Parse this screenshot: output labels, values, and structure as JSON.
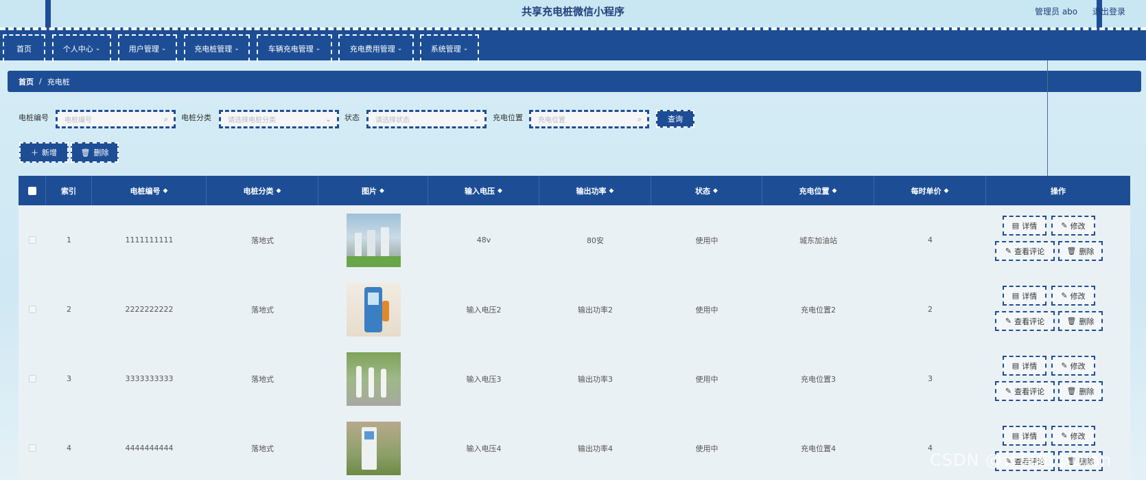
{
  "header": {
    "title": "共享充电桩微信小程序",
    "user": "管理员 abo",
    "logout": "退出登录"
  },
  "nav": [
    {
      "label": "首页",
      "chevron": ""
    },
    {
      "label": "个人中心",
      "chevron": "⌄"
    },
    {
      "label": "用户管理",
      "chevron": "⌄"
    },
    {
      "label": "充电桩管理",
      "chevron": "⌄"
    },
    {
      "label": "车辆充电管理",
      "chevron": "⌄"
    },
    {
      "label": "充电费用管理",
      "chevron": "⌄"
    },
    {
      "label": "系统管理",
      "chevron": "⌄"
    }
  ],
  "breadcrumb": {
    "home": "首页",
    "sep": "/",
    "current": "充电桩"
  },
  "search": {
    "code_label": "电桩编号",
    "code_placeholder": "电桩编号",
    "category_label": "电桩分类",
    "category_placeholder": "请选择电桩分类",
    "status_label": "状态",
    "status_placeholder": "请选择状态",
    "location_label": "充电位置",
    "location_placeholder": "充电位置",
    "query": "查询"
  },
  "toolbar": {
    "add": "新增",
    "delete": "删除",
    "add_icon": "＋",
    "delete_icon": "🗑"
  },
  "table": {
    "columns": [
      "索引",
      "电桩编号",
      "电桩分类",
      "图片",
      "输入电压",
      "输出功率",
      "状态",
      "充电位置",
      "每时单价",
      "操作"
    ],
    "rows": [
      {
        "index": "1",
        "code": "1111111111",
        "category": "落地式",
        "voltage": "48v",
        "power": "80安",
        "status": "使用中",
        "location": "城东加油站",
        "price": "4"
      },
      {
        "index": "2",
        "code": "2222222222",
        "category": "落地式",
        "voltage": "输入电压2",
        "power": "输出功率2",
        "status": "使用中",
        "location": "充电位置2",
        "price": "2"
      },
      {
        "index": "3",
        "code": "3333333333",
        "category": "落地式",
        "voltage": "输入电压3",
        "power": "输出功率3",
        "status": "使用中",
        "location": "充电位置3",
        "price": "3"
      },
      {
        "index": "4",
        "code": "4444444444",
        "category": "落地式",
        "voltage": "输入电压4",
        "power": "输出功率4",
        "status": "使用中",
        "location": "充电位置4",
        "price": "4"
      }
    ],
    "actions": {
      "detail": "详情",
      "edit": "修改",
      "review": "查看评论",
      "delete": "删除"
    }
  },
  "watermark": "CSDN @计算机小Dian",
  "colors": {
    "primary": "#1d4e95",
    "background": "#d6edf6"
  }
}
